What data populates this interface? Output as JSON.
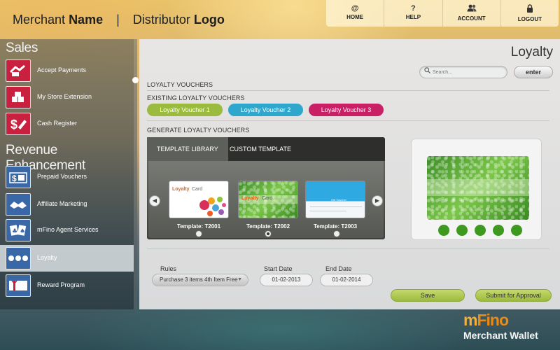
{
  "header": {
    "merchant_prefix": "Merchant",
    "merchant_bold": "Name",
    "separator": "|",
    "distributor_prefix": "Distributor",
    "distributor_bold": "Logo"
  },
  "topnav": {
    "items": [
      {
        "label": "HOME",
        "icon": "at-icon",
        "glyph": "@"
      },
      {
        "label": "HELP",
        "icon": "question-icon",
        "glyph": "?"
      },
      {
        "label": "ACCOUNT",
        "icon": "users-icon",
        "glyph": "👥"
      },
      {
        "label": "LOGOUT",
        "icon": "lock-icon",
        "glyph": "🔒"
      }
    ]
  },
  "sidebar": {
    "sales_title": "Sales",
    "revenue_title": "Revenue Enhancement",
    "items": [
      {
        "label": "Accept Payments",
        "icon": "payments-icon",
        "glyph": "⇄"
      },
      {
        "label": "My Store Extension",
        "icon": "boxes-icon",
        "glyph": "▦"
      },
      {
        "label": "Cash Register",
        "icon": "dollar-tag-icon",
        "glyph": "$"
      },
      {
        "label": "Prepaid Vouchers",
        "icon": "gift-voucher-icon",
        "glyph": "$"
      },
      {
        "label": "Affiliate Marketing",
        "icon": "handshake-icon",
        "glyph": "✋"
      },
      {
        "label": "mFino Agent Services",
        "icon": "cards-icon",
        "glyph": "♣"
      },
      {
        "label": "Loyalty",
        "icon": "loyalty-dots-icon",
        "glyph": "●●●"
      },
      {
        "label": "Reward Program",
        "icon": "reward-ribbon-icon",
        "glyph": "🎁"
      }
    ]
  },
  "main": {
    "page_title": "Loyalty",
    "search": {
      "placeholder": "Search..."
    },
    "enter_label": "enter",
    "loyalty_vouchers_label": "LOYALTY VOUCHERS",
    "existing_label": "EXISTING LOYALTY VOUCHERS",
    "vouchers": [
      {
        "label": "Loyalty Voucher  1",
        "color": "#9bbb3f"
      },
      {
        "label": "Loyalty Voucher  2",
        "color": "#2fa6cc"
      },
      {
        "label": "Loyalty Voucher  3",
        "color": "#c81f65"
      }
    ],
    "generate_label": "GENERATE LOYALTY VOUCHERS",
    "tabs": {
      "library": "TEMPLATE LIBRARY",
      "custom": "CUSTOM TEMPLATE"
    },
    "templates": [
      {
        "name": "Template: T2001",
        "card_title_bold": "Loyalty",
        "card_title": "Card",
        "selected": false
      },
      {
        "name": "Template: T2002",
        "card_title_bold": "Loyalty",
        "card_title": "Card",
        "selected": true
      },
      {
        "name": "Template: T2003",
        "card_title": "Gift Voucher",
        "selected": false
      }
    ],
    "preview_dots": 5,
    "rules_label": "Rules",
    "rules_value": "Purchase 3 items 4th Item Free",
    "start_date_label": "Start Date",
    "start_date": "01-02-2013",
    "end_date_label": "End Date",
    "end_date": "01-02-2014",
    "save_label": "Save",
    "submit_label": "Submit for Approval"
  },
  "footer": {
    "logo_m": "m",
    "logo_rest": "Fino",
    "product": "Merchant Wallet"
  },
  "colors": {
    "accent_green": "#9dba3c",
    "sidebar_red": "#c8203e",
    "sidebar_blue": "#3a67a5",
    "brand_orange": "#e98b14"
  }
}
